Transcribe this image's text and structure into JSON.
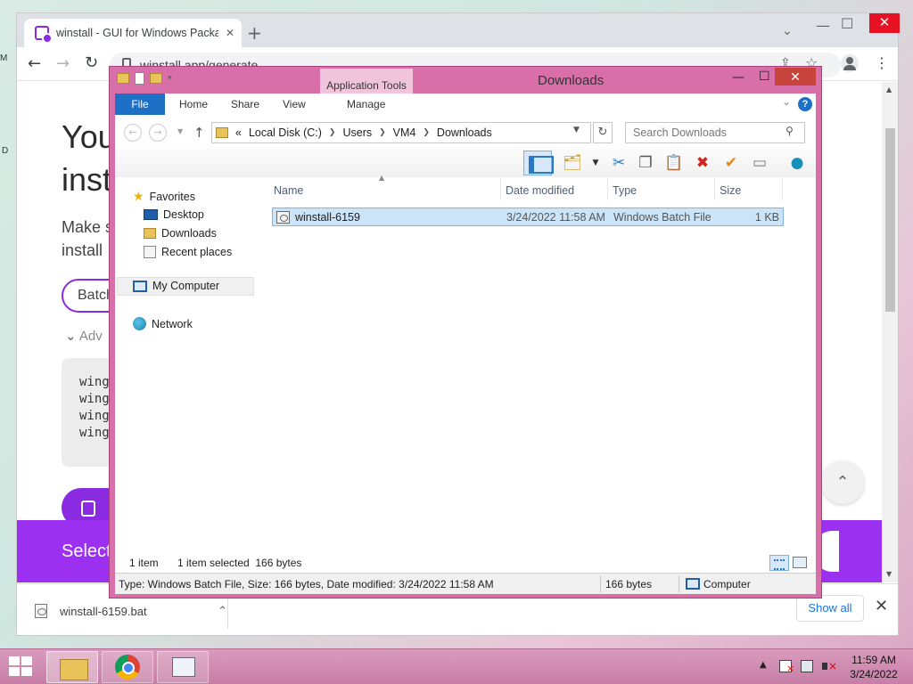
{
  "colors": {
    "accent_purple": "#8a2be2",
    "select_bar": "#9b30f0",
    "explorer_frame": "#d86fa9",
    "file_tab_blue": "#1e6fc6",
    "selection_blue": "#cce4f7",
    "close_red": "#e81123"
  },
  "browser": {
    "tab_title": "winstall - GUI for Windows Packa",
    "url": "winstall.app/generate",
    "page": {
      "heading_line1": "You",
      "heading_line2": "inst",
      "para_line1": "Make s",
      "para_line2": "install",
      "batch_button": "Batch",
      "advanced_toggle": "Adv",
      "code_lines": [
        "wing",
        "wing",
        "wing",
        "wing"
      ],
      "select_bar_text": "Select"
    },
    "download_bar": {
      "filename": "winstall-6159.bat",
      "show_all": "Show all"
    }
  },
  "explorer": {
    "title": "Downloads",
    "context_tab": "Application Tools",
    "ribbon_tabs": {
      "file": "File",
      "home": "Home",
      "share": "Share",
      "view": "View",
      "manage": "Manage"
    },
    "address": {
      "overflow": "«",
      "crumbs": [
        "Local Disk (C:)",
        "Users",
        "VM4",
        "Downloads"
      ]
    },
    "search_placeholder": "Search Downloads",
    "nav_pane": {
      "favorites": "Favorites",
      "desktop": "Desktop",
      "downloads": "Downloads",
      "recent_places": "Recent places",
      "my_computer": "My Computer",
      "network": "Network"
    },
    "columns": {
      "name": "Name",
      "date_modified": "Date modified",
      "type": "Type",
      "size": "Size"
    },
    "files": [
      {
        "name": "winstall-6159",
        "date_modified": "3/24/2022 11:58 AM",
        "type": "Windows Batch File",
        "size": "1 KB"
      }
    ],
    "status": {
      "item_count": "1 item",
      "selection": "1 item selected  166 bytes"
    },
    "details_bar": {
      "info": "Type: Windows Batch File, Size: 166 bytes, Date modified: 3/24/2022 11:58 AM",
      "size": "166 bytes",
      "location": "Computer"
    }
  },
  "taskbar": {
    "time": "11:59 AM",
    "date": "3/24/2022"
  },
  "desktop": {
    "edge_label_1": "M",
    "edge_label_2": "D"
  }
}
